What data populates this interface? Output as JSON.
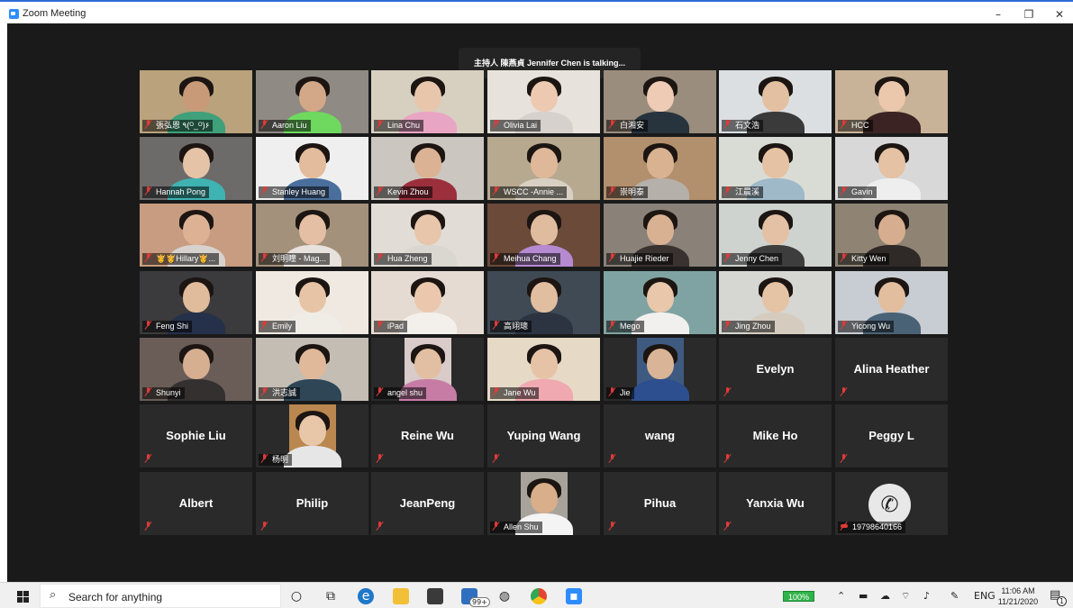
{
  "window": {
    "title": "Zoom Meeting",
    "minimize": "–",
    "maximize": "❐",
    "close": "✕"
  },
  "talking_banner": "主持人 陳燕貞 Jennifer Chen is talking...",
  "colors": {
    "meeting_bg": "#1a1a1a",
    "tile_bg": "#2a2a2a",
    "mute_red": "#e03a3a",
    "accent": "#2d8cff"
  },
  "participants": [
    {
      "name": "張弘恩 ٩(ᴼ_ᴼ)۶",
      "type": "video",
      "bg": "#b9a27c",
      "skin": "#c89a77",
      "shirt": "#3fa07a"
    },
    {
      "name": "Aaron Liu",
      "type": "video",
      "bg": "#8f8a83",
      "skin": "#d3a888",
      "shirt": "#6fd85f"
    },
    {
      "name": "Lina Chu",
      "type": "video",
      "bg": "#d7cfc0",
      "skin": "#e8c6ac",
      "shirt": "#e9a5c4"
    },
    {
      "name": "Olivia Lai",
      "type": "video",
      "bg": "#e7e2db",
      "skin": "#ecc9b0",
      "shirt": "#d6d1cc"
    },
    {
      "name": "白湘安",
      "type": "video",
      "bg": "#9a8d7d",
      "skin": "#edcbb4",
      "shirt": "#27333d"
    },
    {
      "name": "石文浩",
      "type": "video",
      "bg": "#dcdfe2",
      "skin": "#e4c0a3",
      "shirt": "#3a3a3a"
    },
    {
      "name": "HCC",
      "type": "video",
      "bg": "#c9b398",
      "skin": "#ebc7ab",
      "shirt": "#3a2322"
    },
    {
      "name": "Hannah Pong",
      "type": "video",
      "bg": "#6d6a6a",
      "skin": "#e4c3a6",
      "shirt": "#3fb3b2"
    },
    {
      "name": "Stanley Huang",
      "type": "video",
      "bg": "#efefef",
      "skin": "#e2bc9c",
      "shirt": "#4b6f9c"
    },
    {
      "name": "Kevin Zhou",
      "type": "video",
      "bg": "#cbc6bf",
      "skin": "#dbb394",
      "shirt": "#9b2f3c"
    },
    {
      "name": "WSCC -Annie ...",
      "type": "video",
      "bg": "#b7a98f",
      "skin": "#dfb899",
      "shirt": "#d9d0c4"
    },
    {
      "name": "崇明泰",
      "type": "video",
      "bg": "#b28f6d",
      "skin": "#d9b391",
      "shirt": "#b5b0aa"
    },
    {
      "name": "江晨溪",
      "type": "video",
      "bg": "#d9dcd4",
      "skin": "#e6c2a5",
      "shirt": "#9fb9c9"
    },
    {
      "name": "Gavin",
      "type": "video",
      "bg": "#d8d8d8",
      "skin": "#e5c2a4",
      "shirt": "#eeeeee"
    },
    {
      "name": "👸👸Hillary👸...",
      "type": "video",
      "bg": "#c89c80",
      "skin": "#ddb294",
      "shirt": "#d8d2cf"
    },
    {
      "name": "刘明瞳 - Mag...",
      "type": "video",
      "bg": "#a3917b",
      "skin": "#e4bfa3",
      "shirt": "#e8e2dc"
    },
    {
      "name": "Hua Zheng",
      "type": "video",
      "bg": "#e1ddd6",
      "skin": "#e7c6ab",
      "shirt": "#dad6d0"
    },
    {
      "name": "Meihua Chang",
      "type": "video",
      "bg": "#6b4a3a",
      "skin": "#e0bc9e",
      "shirt": "#b68ad0"
    },
    {
      "name": "Huajie Rieder",
      "type": "video",
      "bg": "#8a8179",
      "skin": "#d8b193",
      "shirt": "#3a3230"
    },
    {
      "name": "Jenny Chen",
      "type": "video",
      "bg": "#cfd3d0",
      "skin": "#e4c1a4",
      "shirt": "#3d3d3d"
    },
    {
      "name": "Kitty Wen",
      "type": "video",
      "bg": "#8f8474",
      "skin": "#d6ad8e",
      "shirt": "#2f2a28"
    },
    {
      "name": "Feng Shi",
      "type": "video",
      "bg": "#3b3a3d",
      "skin": "#e0bb9c",
      "shirt": "#25304a"
    },
    {
      "name": "Emily",
      "type": "video",
      "bg": "#efe9e1",
      "skin": "#e8c4a6",
      "shirt": "#f0ece6"
    },
    {
      "name": "iPad",
      "type": "video",
      "bg": "#e6dbd2",
      "skin": "#ebc8ad",
      "shirt": "#f3f0ec"
    },
    {
      "name": "高翊璁",
      "type": "video",
      "bg": "#3f4a55",
      "skin": "#e2bea0",
      "shirt": "#2b3440"
    },
    {
      "name": "Mego",
      "type": "video",
      "bg": "#7fa3a2",
      "skin": "#e9c7ab",
      "shirt": "#f2f0ee"
    },
    {
      "name": "Jing Zhou",
      "type": "video",
      "bg": "#d6d6d2",
      "skin": "#e5c3a5",
      "shirt": "#d5cbbf"
    },
    {
      "name": "Yicong Wu",
      "type": "video",
      "bg": "#c7cdd2",
      "skin": "#e2bd9e",
      "shirt": "#4a6276"
    },
    {
      "name": "Shunyi",
      "type": "video",
      "bg": "#6a5d58",
      "skin": "#d6ae90",
      "shirt": "#33302f"
    },
    {
      "name": "洪志誠",
      "type": "video",
      "bg": "#c4bdb4",
      "skin": "#dfb99a",
      "shirt": "#2f4657"
    },
    {
      "name": "angel shu",
      "type": "portrait",
      "bg": "#d9cbc9",
      "skin": "#e2bfa3",
      "shirt": "#c77ca6"
    },
    {
      "name": "Jane Wu",
      "type": "video",
      "bg": "#e6d9c6",
      "skin": "#e6c3a6",
      "shirt": "#f0a9b1"
    },
    {
      "name": "Jie",
      "type": "portrait",
      "bg": "#3f5a80",
      "skin": "#d9b496",
      "shirt": "#2d4f8f"
    },
    {
      "name": "Evelyn",
      "type": "name"
    },
    {
      "name": "Alina  Heather",
      "type": "name"
    },
    {
      "name": "Sophie Liu",
      "type": "name"
    },
    {
      "name": "杨明",
      "type": "portrait",
      "bg": "#b9874f",
      "skin": "#e8c6a8",
      "shirt": "#e6e6e6"
    },
    {
      "name": "Reine Wu",
      "type": "name"
    },
    {
      "name": "Yuping Wang",
      "type": "name"
    },
    {
      "name": "wang",
      "type": "name"
    },
    {
      "name": "Mike Ho",
      "type": "name"
    },
    {
      "name": "Peggy L",
      "type": "name"
    },
    {
      "name": "Albert",
      "type": "name"
    },
    {
      "name": "Philip",
      "type": "name"
    },
    {
      "name": "JeanPeng",
      "type": "name"
    },
    {
      "name": "Allen Shu",
      "type": "portrait",
      "bg": "#a8a39a",
      "skin": "#d9ae8b",
      "shirt": "#f4f4f4"
    },
    {
      "name": "Pihua",
      "type": "name"
    },
    {
      "name": "Yanxia Wu",
      "type": "name"
    },
    {
      "name": "19798640166",
      "type": "phone",
      "icon": "phone-icon"
    }
  ],
  "taskbar": {
    "search_placeholder": "Search for anything",
    "icons": [
      "start-icon",
      "search-icon",
      "cortana-icon",
      "task-view-icon",
      "edge-icon",
      "file-explorer-icon",
      "store-icon",
      "mail-icon",
      "network-icon",
      "chrome-icon",
      "zoom-icon"
    ],
    "mail_badge": "99+",
    "battery": "100%",
    "language": "ENG",
    "time": "11:06 AM",
    "date": "11/21/2020",
    "notification_count": "1"
  }
}
